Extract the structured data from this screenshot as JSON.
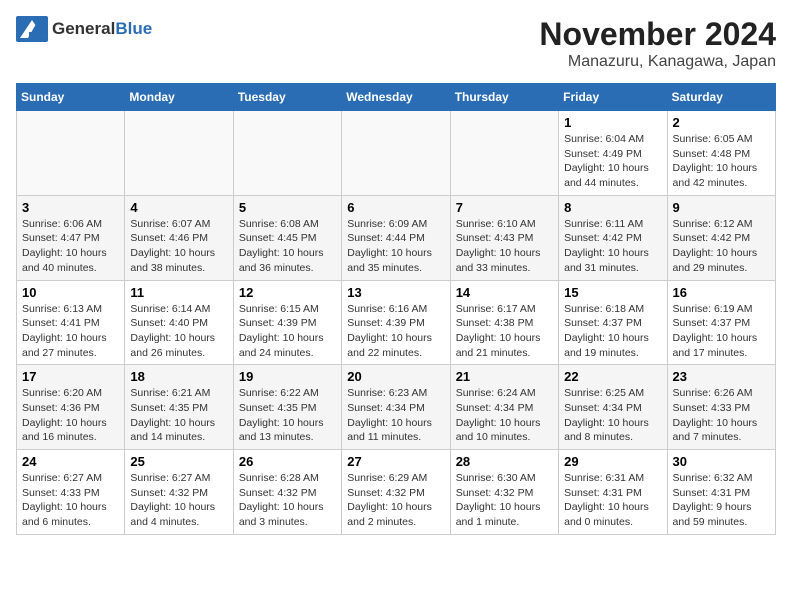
{
  "logo": {
    "general": "General",
    "blue": "Blue"
  },
  "title": "November 2024",
  "subtitle": "Manazuru, Kanagawa, Japan",
  "headers": [
    "Sunday",
    "Monday",
    "Tuesday",
    "Wednesday",
    "Thursday",
    "Friday",
    "Saturday"
  ],
  "weeks": [
    [
      {
        "day": "",
        "info": ""
      },
      {
        "day": "",
        "info": ""
      },
      {
        "day": "",
        "info": ""
      },
      {
        "day": "",
        "info": ""
      },
      {
        "day": "",
        "info": ""
      },
      {
        "day": "1",
        "info": "Sunrise: 6:04 AM\nSunset: 4:49 PM\nDaylight: 10 hours\nand 44 minutes."
      },
      {
        "day": "2",
        "info": "Sunrise: 6:05 AM\nSunset: 4:48 PM\nDaylight: 10 hours\nand 42 minutes."
      }
    ],
    [
      {
        "day": "3",
        "info": "Sunrise: 6:06 AM\nSunset: 4:47 PM\nDaylight: 10 hours\nand 40 minutes."
      },
      {
        "day": "4",
        "info": "Sunrise: 6:07 AM\nSunset: 4:46 PM\nDaylight: 10 hours\nand 38 minutes."
      },
      {
        "day": "5",
        "info": "Sunrise: 6:08 AM\nSunset: 4:45 PM\nDaylight: 10 hours\nand 36 minutes."
      },
      {
        "day": "6",
        "info": "Sunrise: 6:09 AM\nSunset: 4:44 PM\nDaylight: 10 hours\nand 35 minutes."
      },
      {
        "day": "7",
        "info": "Sunrise: 6:10 AM\nSunset: 4:43 PM\nDaylight: 10 hours\nand 33 minutes."
      },
      {
        "day": "8",
        "info": "Sunrise: 6:11 AM\nSunset: 4:42 PM\nDaylight: 10 hours\nand 31 minutes."
      },
      {
        "day": "9",
        "info": "Sunrise: 6:12 AM\nSunset: 4:42 PM\nDaylight: 10 hours\nand 29 minutes."
      }
    ],
    [
      {
        "day": "10",
        "info": "Sunrise: 6:13 AM\nSunset: 4:41 PM\nDaylight: 10 hours\nand 27 minutes."
      },
      {
        "day": "11",
        "info": "Sunrise: 6:14 AM\nSunset: 4:40 PM\nDaylight: 10 hours\nand 26 minutes."
      },
      {
        "day": "12",
        "info": "Sunrise: 6:15 AM\nSunset: 4:39 PM\nDaylight: 10 hours\nand 24 minutes."
      },
      {
        "day": "13",
        "info": "Sunrise: 6:16 AM\nSunset: 4:39 PM\nDaylight: 10 hours\nand 22 minutes."
      },
      {
        "day": "14",
        "info": "Sunrise: 6:17 AM\nSunset: 4:38 PM\nDaylight: 10 hours\nand 21 minutes."
      },
      {
        "day": "15",
        "info": "Sunrise: 6:18 AM\nSunset: 4:37 PM\nDaylight: 10 hours\nand 19 minutes."
      },
      {
        "day": "16",
        "info": "Sunrise: 6:19 AM\nSunset: 4:37 PM\nDaylight: 10 hours\nand 17 minutes."
      }
    ],
    [
      {
        "day": "17",
        "info": "Sunrise: 6:20 AM\nSunset: 4:36 PM\nDaylight: 10 hours\nand 16 minutes."
      },
      {
        "day": "18",
        "info": "Sunrise: 6:21 AM\nSunset: 4:35 PM\nDaylight: 10 hours\nand 14 minutes."
      },
      {
        "day": "19",
        "info": "Sunrise: 6:22 AM\nSunset: 4:35 PM\nDaylight: 10 hours\nand 13 minutes."
      },
      {
        "day": "20",
        "info": "Sunrise: 6:23 AM\nSunset: 4:34 PM\nDaylight: 10 hours\nand 11 minutes."
      },
      {
        "day": "21",
        "info": "Sunrise: 6:24 AM\nSunset: 4:34 PM\nDaylight: 10 hours\nand 10 minutes."
      },
      {
        "day": "22",
        "info": "Sunrise: 6:25 AM\nSunset: 4:34 PM\nDaylight: 10 hours\nand 8 minutes."
      },
      {
        "day": "23",
        "info": "Sunrise: 6:26 AM\nSunset: 4:33 PM\nDaylight: 10 hours\nand 7 minutes."
      }
    ],
    [
      {
        "day": "24",
        "info": "Sunrise: 6:27 AM\nSunset: 4:33 PM\nDaylight: 10 hours\nand 6 minutes."
      },
      {
        "day": "25",
        "info": "Sunrise: 6:27 AM\nSunset: 4:32 PM\nDaylight: 10 hours\nand 4 minutes."
      },
      {
        "day": "26",
        "info": "Sunrise: 6:28 AM\nSunset: 4:32 PM\nDaylight: 10 hours\nand 3 minutes."
      },
      {
        "day": "27",
        "info": "Sunrise: 6:29 AM\nSunset: 4:32 PM\nDaylight: 10 hours\nand 2 minutes."
      },
      {
        "day": "28",
        "info": "Sunrise: 6:30 AM\nSunset: 4:32 PM\nDaylight: 10 hours\nand 1 minute."
      },
      {
        "day": "29",
        "info": "Sunrise: 6:31 AM\nSunset: 4:31 PM\nDaylight: 10 hours\nand 0 minutes."
      },
      {
        "day": "30",
        "info": "Sunrise: 6:32 AM\nSunset: 4:31 PM\nDaylight: 9 hours\nand 59 minutes."
      }
    ]
  ]
}
